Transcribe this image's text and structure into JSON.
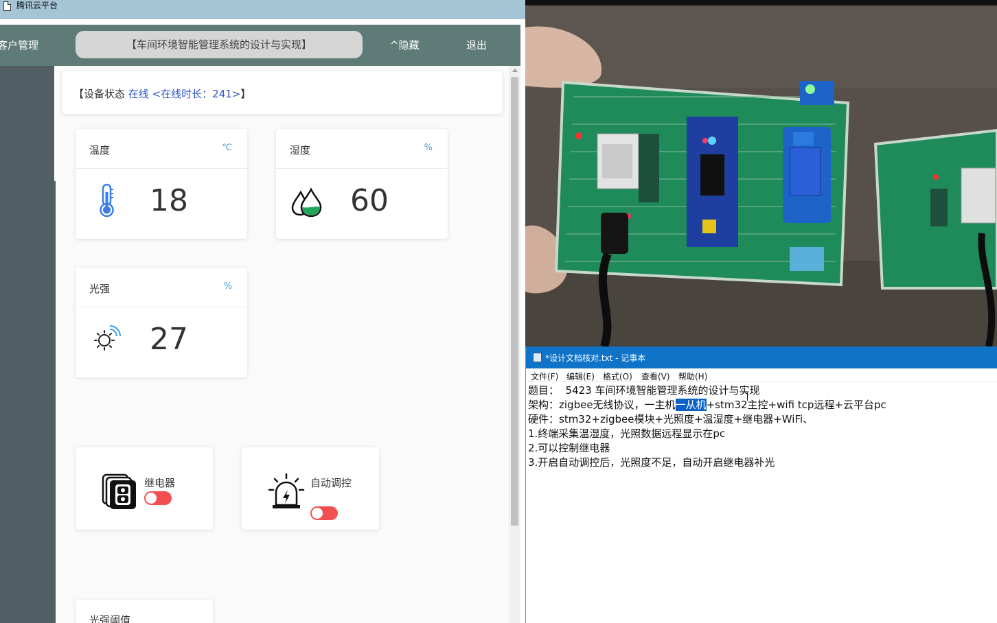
{
  "browser": {
    "window_title": "腾讯云平台"
  },
  "top_nav": {
    "left_label": "客户管理",
    "system_title": "【车间环境智能管理系统的设计与实现】",
    "hide_label": "^隐藏",
    "logout_label": "退出"
  },
  "device_status": {
    "prefix": "【设备状态 ",
    "state": "在线",
    "online_time_text": "<在线时长：241>",
    "suffix": "】"
  },
  "sensors": [
    {
      "name": "温度",
      "unit": "℃",
      "value": "18",
      "icon": "thermometer-icon"
    },
    {
      "name": "湿度",
      "unit": "%",
      "value": "60",
      "icon": "humidity-drops-icon"
    },
    {
      "name": "光强",
      "unit": "%",
      "value": "27",
      "icon": "sun-light-icon"
    }
  ],
  "controls": {
    "relay": {
      "label": "继电器",
      "on": false,
      "icon": "relay-switch-icon"
    },
    "auto": {
      "label": "自动调控",
      "on": false,
      "icon": "alarm-light-icon"
    },
    "threshold": {
      "label": "光强阈值"
    }
  },
  "colors": {
    "nav_bg": "#5f7b77",
    "toggle_off": "#f25050",
    "status_blue": "#2a53c8",
    "notepad_title": "#0f73c8"
  },
  "notepad": {
    "title": "*设计文档核对.txt - 记事本",
    "menu": [
      "文件(F)",
      "编辑(E)",
      "格式(O)",
      "查看(V)",
      "帮助(H)"
    ],
    "line1": "题目：  5423 车间环境智能管理系统的设计与实现",
    "line2_before": "架构：zigbee无线协议，一主机",
    "line2_selected": "一从机",
    "line2_after": "+stm32主控+wifi tcp远程+云平台pc",
    "line3": "硬件：stm32+zigbee模块+光照度+温湿度+继电器+WiFi、",
    "line4": "1.终端采集温湿度，光照数据远程显示在pc",
    "line5": "2.可以控制继电器",
    "line6": "3.开启自动调控后，光照度不足，自动开启继电器补光"
  }
}
